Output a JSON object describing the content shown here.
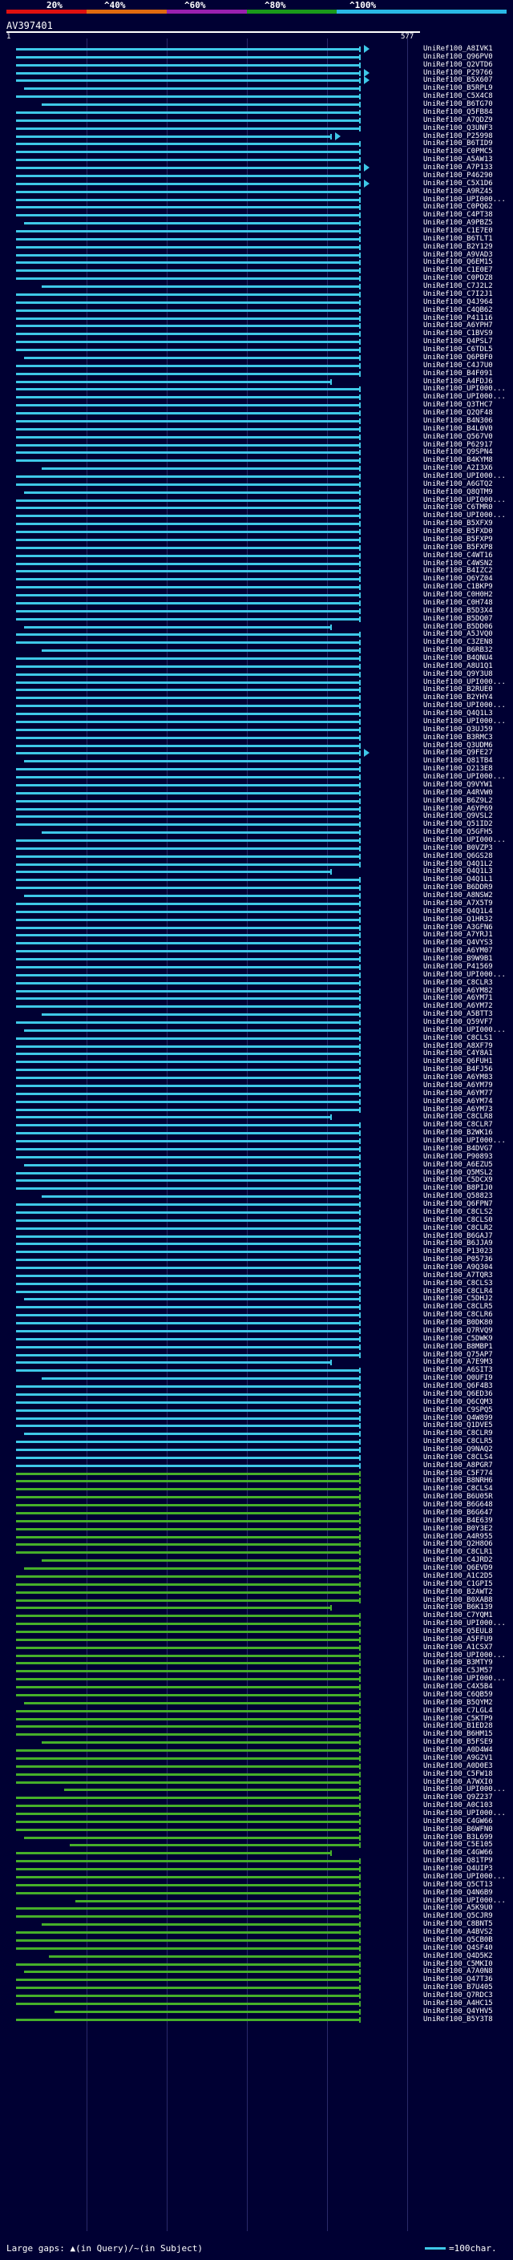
{
  "score_bar": {
    "labels": [
      "20%",
      "^40%",
      "^60%",
      "^80%",
      "^100%"
    ],
    "colors": [
      "#e01010",
      "#e06a10",
      "#9a20b0",
      "#1a9a1a",
      "#2ab8e6"
    ]
  },
  "query": {
    "name": "AV397401",
    "start": "1",
    "end": "577"
  },
  "colors": {
    "cyan_hit": "#3ec8e8",
    "green_hit": "#46b02a",
    "background": "#000033"
  },
  "hits": [
    "UniRef100_A8IVK1",
    "UniRef100_Q96PV0",
    "UniRef100_Q2VTD6",
    "UniRef100_P29766",
    "UniRef100_B5X607",
    "UniRef100_B5RPL9",
    "UniRef100_C5X4C8",
    "UniRef100_B6TG70",
    "UniRef100_Q5FB84",
    "UniRef100_A7QDZ9",
    "UniRef100_Q3UNF3",
    "UniRef100_P25998",
    "UniRef100_B6TID9",
    "UniRef100_C0PMC5",
    "UniRef100_A5AW13",
    "UniRef100_A7P133",
    "UniRef100_P46290",
    "UniRef100_C5X1D6",
    "UniRef100_A9RZ45",
    "UniRef100_UPI000...",
    "UniRef100_C0PQ62",
    "UniRef100_C4PT38",
    "UniRef100_A9PBZ5",
    "UniRef100_C1E7E0",
    "UniRef100_B6TLT1",
    "UniRef100_B2Y129",
    "UniRef100_A9VAD3",
    "UniRef100_Q6EM15",
    "UniRef100_C1E0E7",
    "UniRef100_C0PDZ8",
    "UniRef100_C7J2L2",
    "UniRef100_C7I2J1",
    "UniRef100_Q4J964",
    "UniRef100_C4QB62",
    "UniRef100_P41116",
    "UniRef100_A6YPH7",
    "UniRef100_C1BVS9",
    "UniRef100_Q4PSL7",
    "UniRef100_C6TDL5",
    "UniRef100_Q6PBF0",
    "UniRef100_C4J7U0",
    "UniRef100_B4F091",
    "UniRef100_A4FDJ6",
    "UniRef100_UPI000...",
    "UniRef100_UPI000...",
    "UniRef100_Q3THC7",
    "UniRef100_Q2QF48",
    "UniRef100_B4N306",
    "UniRef100_B4L0V0",
    "UniRef100_Q567V0",
    "UniRef100_P62917",
    "UniRef100_Q9SPN4",
    "UniRef100_B4KYM8",
    "UniRef100_A2I3X6",
    "UniRef100_UPI000...",
    "UniRef100_A6GTQ2",
    "UniRef100_Q8QTM9",
    "UniRef100_UPI000...",
    "UniRef100_C6TMR0",
    "UniRef100_UPI000...",
    "UniRef100_B5XFX9",
    "UniRef100_B5FXD0",
    "UniRef100_B5FXP9",
    "UniRef100_B5FXP8",
    "UniRef100_C4WT16",
    "UniRef100_C4WSN2",
    "UniRef100_B4IZC2",
    "UniRef100_Q6YZ04",
    "UniRef100_C1BKP9",
    "UniRef100_C0H0H2",
    "UniRef100_C0H748",
    "UniRef100_B5D3X4",
    "UniRef100_B5DQ07",
    "UniRef100_B5DD06",
    "UniRef100_A5JVQ0",
    "UniRef100_C3ZEN8",
    "UniRef100_B6RB32",
    "UniRef100_B4QNU4",
    "UniRef100_A8U1Q1",
    "UniRef100_Q9Y3U8",
    "UniRef100_UPI000...",
    "UniRef100_B2RUE0",
    "UniRef100_B2YHY4",
    "UniRef100_UPI000...",
    "UniRef100_Q4Q1L3",
    "UniRef100_UPI000...",
    "UniRef100_Q3UJ59",
    "UniRef100_B3RMC3",
    "UniRef100_Q3UDM6",
    "UniRef100_Q9FE27",
    "UniRef100_Q81TB4",
    "UniRef100_Q213E8",
    "UniRef100_UPI000...",
    "UniRef100_Q9VYW1",
    "UniRef100_A4RVW0",
    "UniRef100_B6Z9L2",
    "UniRef100_A6YP69",
    "UniRef100_Q9VSL2",
    "UniRef100_Q51ID2",
    "UniRef100_Q5GFH5",
    "UniRef100_UPI000...",
    "UniRef100_B0VZP3",
    "UniRef100_Q6GS28",
    "UniRef100_Q4Q1L2",
    "UniRef100_Q4Q1L3",
    "UniRef100_Q4Q1L1",
    "UniRef100_B6DDR9",
    "UniRef100_A8NSW2",
    "UniRef100_A7X5T9",
    "UniRef100_Q4Q1L4",
    "UniRef100_Q1HR32",
    "UniRef100_A3GFN6",
    "UniRef100_A7YRJ1",
    "UniRef100_Q4VYS3",
    "UniRef100_A6YM07",
    "UniRef100_B9W9B1",
    "UniRef100_P41569",
    "UniRef100_UPI000...",
    "UniRef100_C8CLR3",
    "UniRef100_A6YM82",
    "UniRef100_A6YM71",
    "UniRef100_A6YM72",
    "UniRef100_A5BTT3",
    "UniRef100_Q59VF7",
    "UniRef100_UPI000...",
    "UniRef100_C8CLS1",
    "UniRef100_A8XF79",
    "UniRef100_C4Y8A1",
    "UniRef100_Q6FUH1",
    "UniRef100_B4FJ56",
    "UniRef100_A6YM83",
    "UniRef100_A6YM79",
    "UniRef100_A6YM77",
    "UniRef100_A6YM74",
    "UniRef100_A6YM73",
    "UniRef100_C8CLR8",
    "UniRef100_C8CLR7",
    "UniRef100_B2WK16",
    "UniRef100_UPI000...",
    "UniRef100_B4DVG7",
    "UniRef100_P90893",
    "UniRef100_A6EZU5",
    "UniRef100_Q5MSL2",
    "UniRef100_C5DCX9",
    "UniRef100_B8PIJ0",
    "UniRef100_Q58823",
    "UniRef100_Q6FPN7",
    "UniRef100_C8CLS2",
    "UniRef100_C8CLS0",
    "UniRef100_C8CLR2",
    "UniRef100_B6GAJ7",
    "UniRef100_B6JJA9",
    "UniRef100_P13023",
    "UniRef100_P05736",
    "UniRef100_A9Q304",
    "UniRef100_A7TQR3",
    "UniRef100_C8CLS3",
    "UniRef100_C8CLR4",
    "UniRef100_C5DHJ2",
    "UniRef100_C8CLR5",
    "UniRef100_C8CLR6",
    "UniRef100_B0DK80",
    "UniRef100_Q7RVQ9",
    "UniRef100_C5DWK9",
    "UniRef100_B8MBP1",
    "UniRef100_Q75AP7",
    "UniRef100_A7E9M3",
    "UniRef100_A6SIT3",
    "UniRef100_Q0UFI9",
    "UniRef100_Q6F4B3",
    "UniRef100_Q6ED36",
    "UniRef100_Q6CQM3",
    "UniRef100_C9SPQ5",
    "UniRef100_Q4W899",
    "UniRef100_Q1DVE5",
    "UniRef100_C8CLR9",
    "UniRef100_C8CLR5",
    "UniRef100_Q9NAQ2",
    "UniRef100_C8CLS4",
    "UniRef100_A8PGR7",
    "UniRef100_C5F774",
    "UniRef100_B8NRH6",
    "UniRef100_C8CLS4",
    "UniRef100_B6U05R",
    "UniRef100_B6G648",
    "UniRef100_B6G647",
    "UniRef100_B4E639",
    "UniRef100_B0Y3E2",
    "UniRef100_A4R955",
    "UniRef100_Q2H8O6",
    "UniRef100_C8CLR1",
    "UniRef100_C4JRD2",
    "UniRef100_Q6EVD9",
    "UniRef100_A1C2D5",
    "UniRef100_C1GPI5",
    "UniRef100_B2AWT2",
    "UniRef100_B0XAB8",
    "UniRef100_B6K139",
    "UniRef100_C7YQM1",
    "UniRef100_UPI000...",
    "UniRef100_Q5EUL8",
    "UniRef100_A5FFU9",
    "UniRef100_A1CSX7",
    "UniRef100_UPI000...",
    "UniRef100_B3MTY9",
    "UniRef100_C5JM57",
    "UniRef100_UPI000...",
    "UniRef100_C4X5B4",
    "UniRef100_C6QB59",
    "UniRef100_B5QYM2",
    "UniRef100_C7LGL4",
    "UniRef100_C5KTP9",
    "UniRef100_B1ED28",
    "UniRef100_B6HM15",
    "UniRef100_B5FSE9",
    "UniRef100_A0D4W4",
    "UniRef100_A9G2V1",
    "UniRef100_A0D0E3",
    "UniRef100_C5FW18",
    "UniRef100_A7WXI0",
    "UniRef100_UPI000...",
    "UniRef100_Q9Z237",
    "UniRef100_A0C103",
    "UniRef100_UPI000...",
    "UniRef100_C4GW66",
    "UniRef100_B6WFN0",
    "UniRef100_B3L699",
    "UniRef100_C5E105",
    "UniRef100_C4GW66",
    "UniRef100_Q81TP9",
    "UniRef100_Q4UIP3",
    "UniRef100_UPI000...",
    "UniRef100_Q5CT13",
    "UniRef100_Q4N6B9",
    "UniRef100_UPI000...",
    "UniRef100_A5K9U0",
    "UniRef100_Q5CJR9",
    "UniRef100_C8BNT5",
    "UniRef100_A4BVS2",
    "UniRef100_Q5CB0B",
    "UniRef100_Q4SF40",
    "UniRef100_Q4D5K2",
    "UniRef100_C5MKI0",
    "UniRef100_A7A0N8",
    "UniRef100_Q47T36",
    "UniRef100_B7U405",
    "UniRef100_Q7RDC3",
    "UniRef100_A4HC15",
    "UniRef100_Q4YHV5",
    "UniRef100_B5Y3T8"
  ],
  "footer": {
    "gaps_label": "Large gaps: ▲(in Query)/~(in Subject)",
    "scale_label": "=100char."
  }
}
